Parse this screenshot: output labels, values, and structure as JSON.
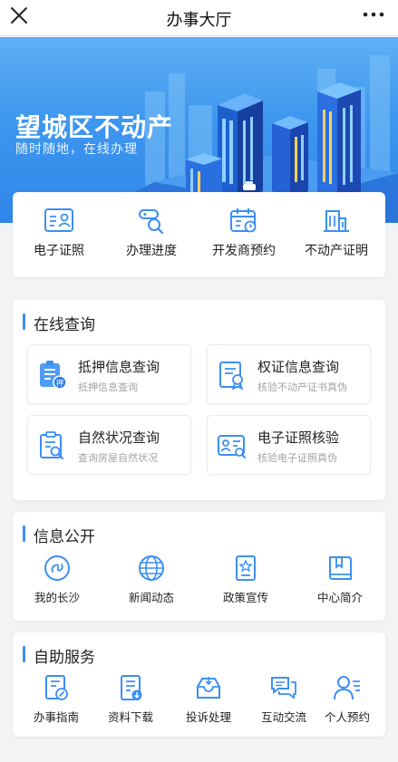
{
  "header": {
    "title": "办事大厅",
    "close_icon": "close-icon",
    "more_icon": "more-icon"
  },
  "banner": {
    "title": "望城区不动产",
    "subtitle": "随时随地，在线办理"
  },
  "quick_actions": [
    {
      "label": "电子证照",
      "icon": "id-card-icon"
    },
    {
      "label": "办理进度",
      "icon": "progress-search-icon"
    },
    {
      "label": "开发商预约",
      "icon": "calendar-icon"
    },
    {
      "label": "不动产证明",
      "icon": "building-icon"
    }
  ],
  "online_query": {
    "title": "在线查询",
    "items": [
      {
        "title": "抵押信息查询",
        "desc": "抵押信息查询",
        "icon": "mortgage-doc-icon"
      },
      {
        "title": "权证信息查询",
        "desc": "核验不动产证书真伪",
        "icon": "certificate-icon"
      },
      {
        "title": "自然状况查询",
        "desc": "查询房屋自然状况",
        "icon": "clipboard-search-icon"
      },
      {
        "title": "电子证照核验",
        "desc": "核验电子证照真伪",
        "icon": "id-verify-icon"
      }
    ]
  },
  "info_public": {
    "title": "信息公开",
    "items": [
      {
        "label": "我的长沙",
        "icon": "city-circle-icon"
      },
      {
        "label": "新闻动态",
        "icon": "globe-icon"
      },
      {
        "label": "政策宣传",
        "icon": "policy-book-icon"
      },
      {
        "label": "中心简介",
        "icon": "bookmark-book-icon"
      }
    ]
  },
  "self_service": {
    "title": "自助服务",
    "items": [
      {
        "label": "办事指南",
        "icon": "guide-icon"
      },
      {
        "label": "资料下载",
        "icon": "download-doc-icon"
      },
      {
        "label": "投诉处理",
        "icon": "complaint-inbox-icon"
      },
      {
        "label": "互动交流",
        "icon": "chat-icon"
      },
      {
        "label": "个人预约",
        "icon": "person-appointment-icon"
      }
    ]
  },
  "colors": {
    "accent": "#3b8ff2",
    "banner": "#3e97ef",
    "background": "#f2f3f5"
  }
}
